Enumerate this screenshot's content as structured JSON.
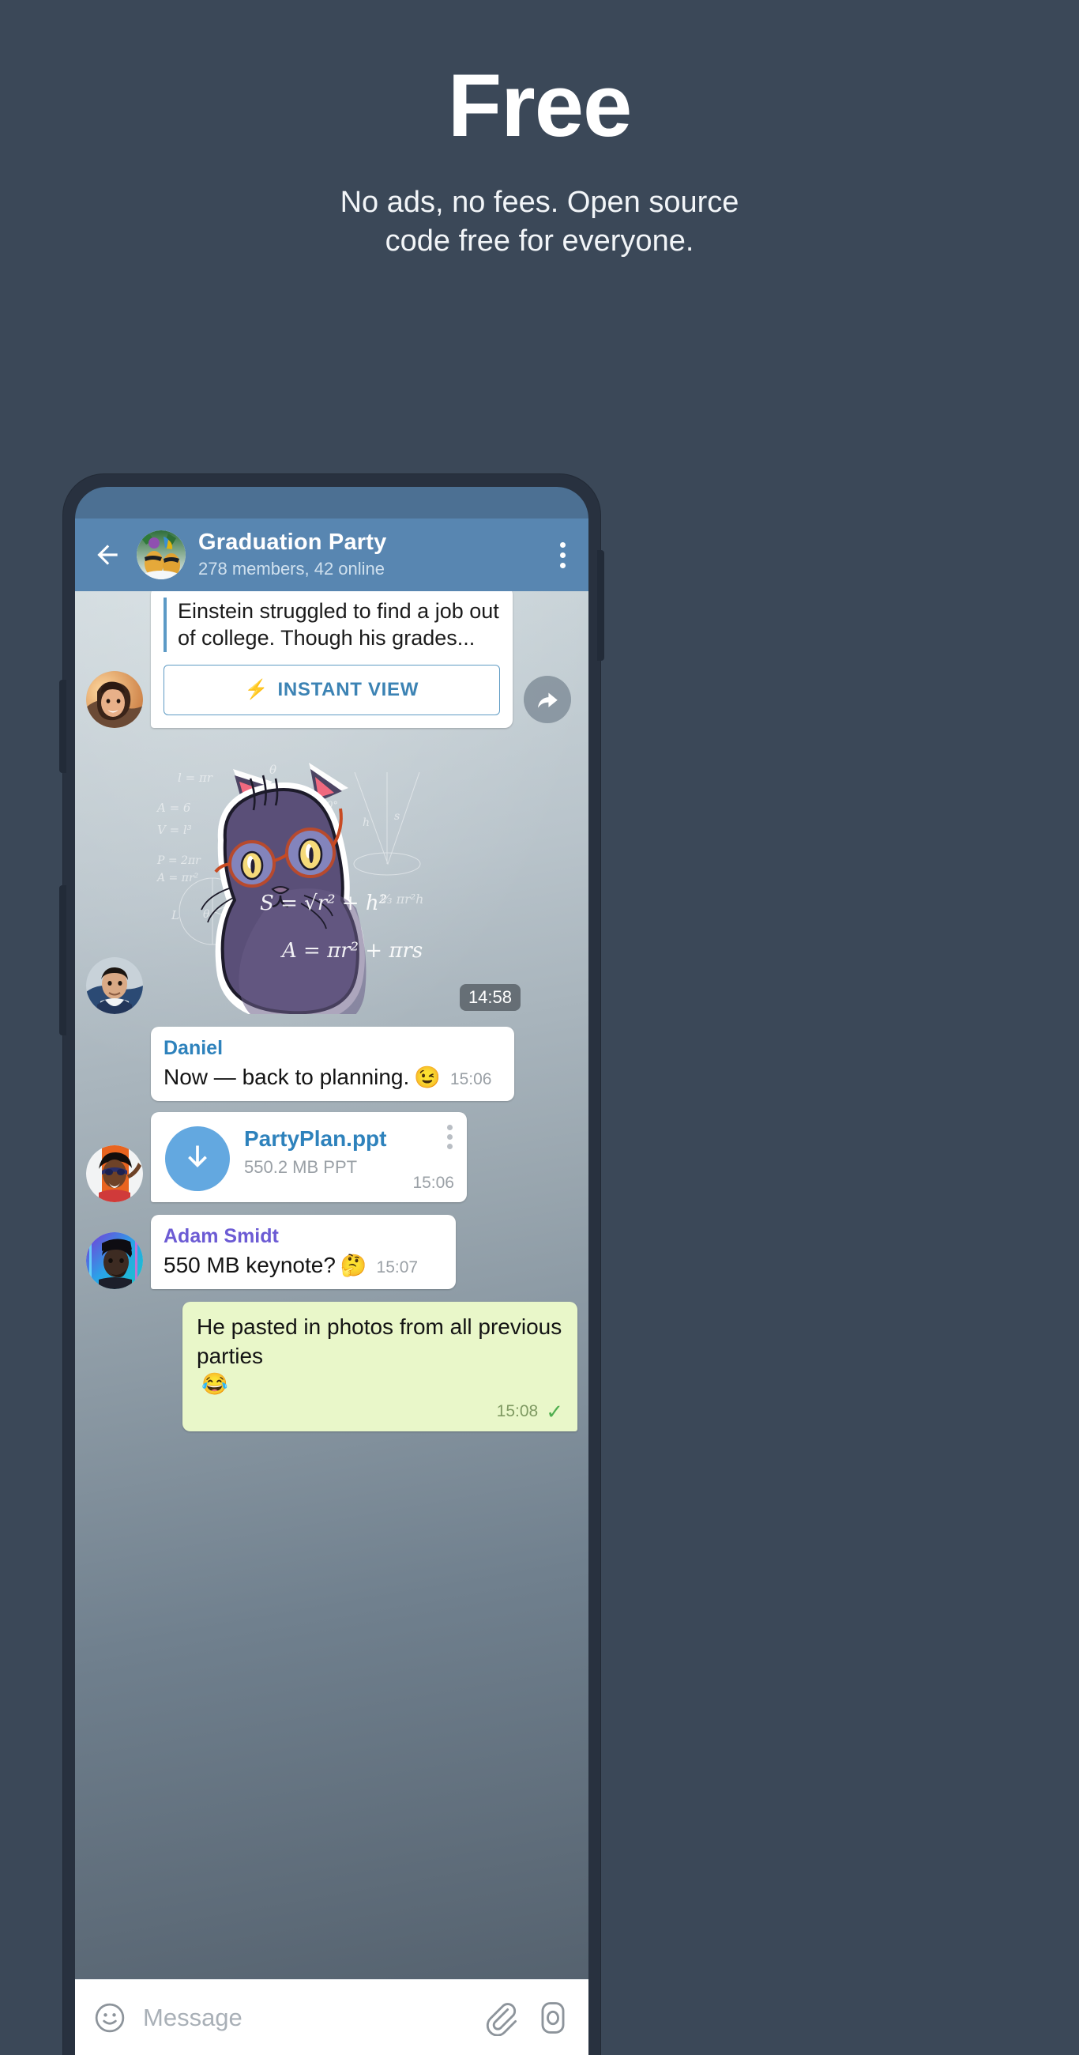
{
  "hero": {
    "title": "Free",
    "subtitle_line1": "No ads, no fees. Open source",
    "subtitle_line2": "code free for everyone."
  },
  "colors": {
    "page_background": "#3b4858",
    "phone_frame": "#28313f",
    "status_bar": "#4c7093",
    "header_bar": "#5886b1",
    "accent_link": "#2e82bc",
    "outgoing_bubble": "#e9f7c9",
    "incoming_bubble": "#ffffff",
    "sender_blue": "#2e82bc",
    "sender_purple": "#6c5bd4",
    "check_green": "#4fae4f",
    "download_circle": "#63a8e0"
  },
  "chat": {
    "header": {
      "back_icon": "back-arrow-icon",
      "avatar_icon": "group-avatar",
      "title": "Graduation Party",
      "subtitle": "278 members, 42 online",
      "menu_icon": "kebab-menu-icon"
    },
    "messages": [
      {
        "type": "instant_view",
        "avatar": "avatar-woman-sunset",
        "quote_text": "Einstein struggled to find a job out of college. Though his grades...",
        "button_label": "INSTANT VIEW",
        "button_icon": "lightning-bolt-icon",
        "forward_icon": "forward-arrow-icon"
      },
      {
        "type": "sticker",
        "avatar": "avatar-young-man",
        "sticker_name": "math-cat-sticker",
        "time": "14:58"
      },
      {
        "type": "text",
        "sender": "Daniel",
        "sender_color": "blue",
        "text": "Now — back to planning.",
        "emoji": "😉",
        "time": "15:06"
      },
      {
        "type": "file",
        "avatar": "avatar-man-orange",
        "file_name": "PartyPlan.ppt",
        "file_meta": "550.2 MB PPT",
        "time": "15:06",
        "download_icon": "download-arrow-icon",
        "menu_icon": "kebab-menu-icon"
      },
      {
        "type": "text",
        "avatar": "avatar-man-neon",
        "sender": "Adam Smidt",
        "sender_color": "purple",
        "text": "550 MB keynote?",
        "emoji": "🤔",
        "time": "15:07"
      },
      {
        "type": "outgoing",
        "text": "He pasted in photos from all previous parties",
        "emoji": "😂",
        "time": "15:08",
        "status_icon": "single-check-icon"
      }
    ],
    "input_bar": {
      "emoji_icon": "smiley-face-icon",
      "placeholder": "Message",
      "attach_icon": "paperclip-icon",
      "camera_icon": "camera-icon"
    }
  }
}
